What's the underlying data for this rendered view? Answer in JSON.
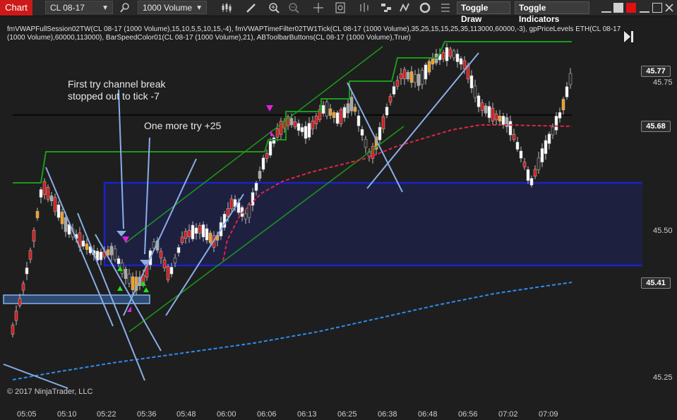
{
  "toolbar": {
    "chart_tab": "Chart",
    "instrument": "CL 08-17",
    "bar_type": "1000 Volume",
    "toggle_draw": "Toggle Draw",
    "toggle_indicators": "Toggle Indicators"
  },
  "header": {
    "indicators_line": "fmVWAPFullSession02TW(CL 08-17 (1000 Volume),15,10,5,5,10,15,-4), fmVWAPTimeFilter02TW1Tick(CL 08-17 (1000 Volume),35,25,15,15,25,35,113000,60000,-3), gpPriceLevels ETH(CL 08-17 (1000 Volume),60000,113000), BarSpeedColor01(CL 08-17 (1000 Volume),21), ABToolbarButtons(CL 08-17 (1000 Volume),True)"
  },
  "annotations": {
    "note1_line1": "First try channel break",
    "note1_line2": "stopped out to tick -7",
    "note2": "One more try +25"
  },
  "copyright": "© 2017 NinjaTrader, LLC",
  "colors": {
    "accent_red": "#cc1a1a",
    "vwap_full": "#2a8ef0",
    "vwap_filter": "#e0244a",
    "level_green": "#1a9a1a",
    "box_blue": "#1a22c8",
    "trendline": "#8aaee8"
  },
  "chart_data": {
    "type": "candlestick",
    "instrument": "CL 08-17",
    "x_ticks": [
      "05:05",
      "05:10",
      "05:22",
      "05:36",
      "05:48",
      "06:00",
      "06:06",
      "06:13",
      "06:25",
      "06:38",
      "06:48",
      "06:56",
      "07:02",
      "07:09"
    ],
    "y_ticks": [
      "45.75",
      "45.50",
      "45.25"
    ],
    "price_tags": [
      "45.77",
      "45.68",
      "45.41"
    ],
    "ylim": [
      45.2,
      45.85
    ],
    "grid": false
  }
}
